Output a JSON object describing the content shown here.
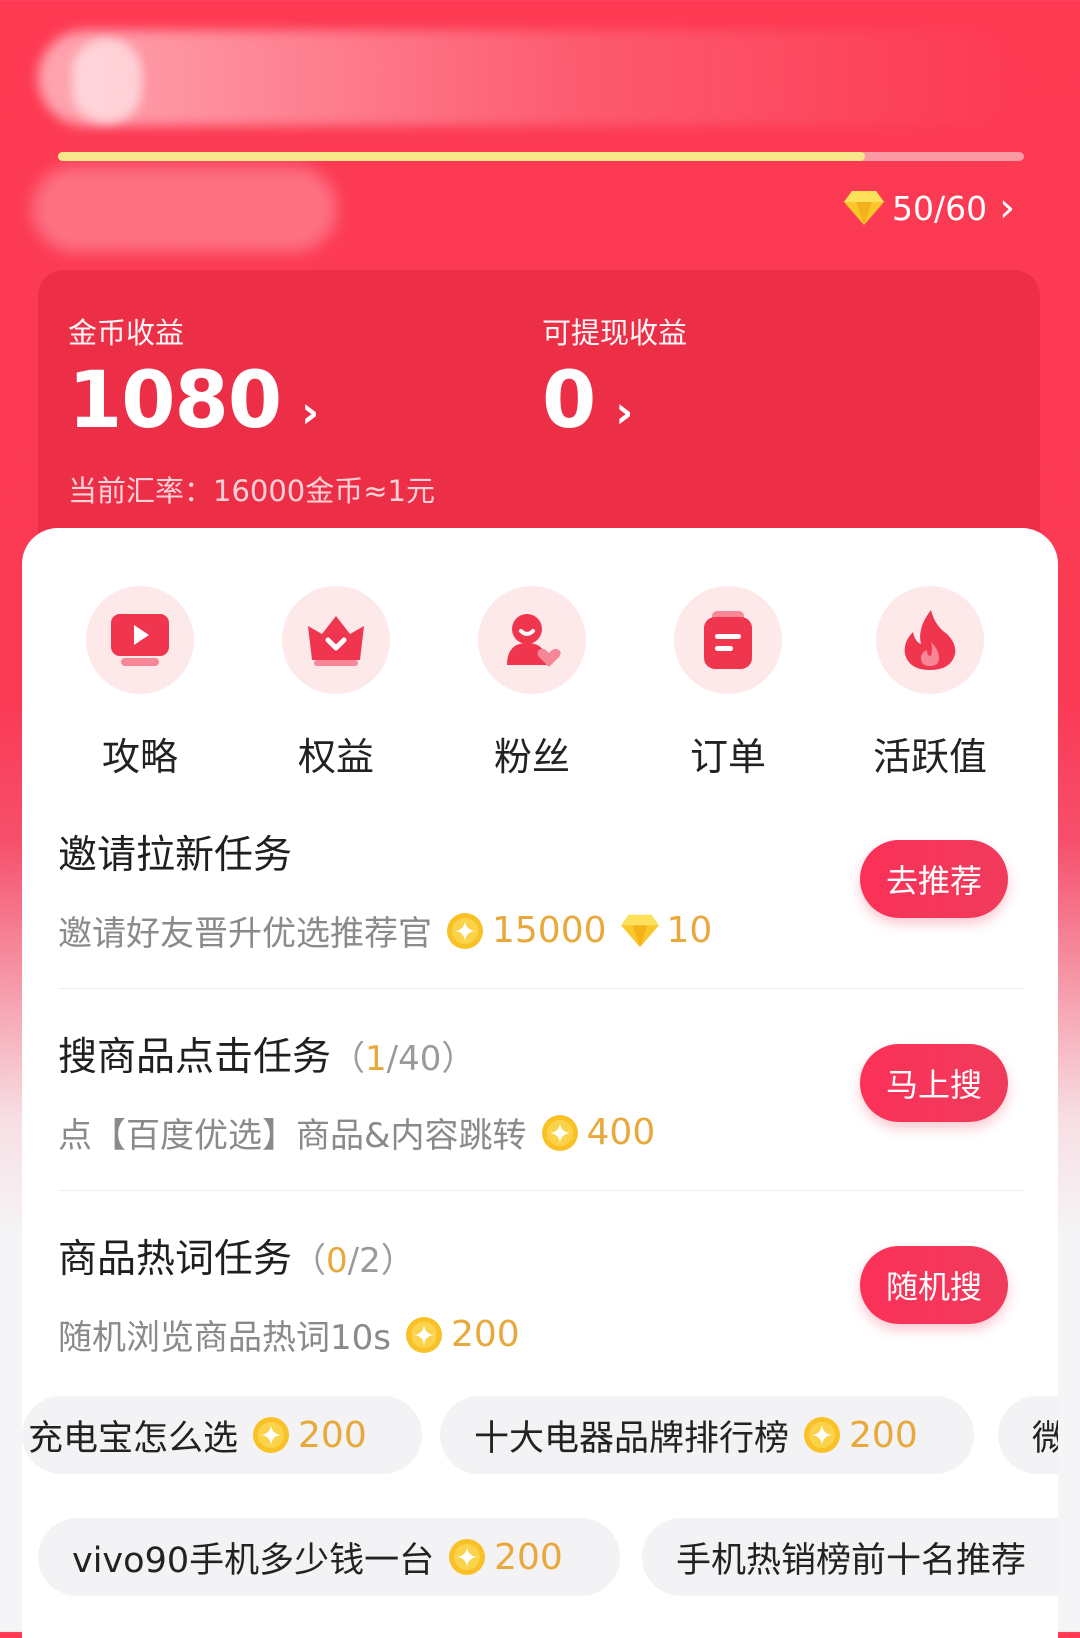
{
  "header": {
    "level_progress": 0.835,
    "gem_count": "50/60",
    "chevron": "›"
  },
  "earnings": {
    "coin_label": "金币收益",
    "coin_value": "1080",
    "cash_label": "可提现收益",
    "cash_value": "0",
    "arrow": "›",
    "rate_text": "当前汇率：16000金币≈1元"
  },
  "entries": [
    {
      "label": "攻略",
      "icon": "play-screen-icon"
    },
    {
      "label": "权益",
      "icon": "crown-heart-icon"
    },
    {
      "label": "粉丝",
      "icon": "fans-heart-icon"
    },
    {
      "label": "订单",
      "icon": "order-list-icon"
    },
    {
      "label": "活跃值",
      "icon": "flame-icon"
    }
  ],
  "tasks": [
    {
      "title": "邀请拉新任务",
      "desc": "邀请好友晋升优选推荐官",
      "coins": "15000",
      "gems": "10",
      "button": "去推荐"
    },
    {
      "title": "搜商品点击任务",
      "progress_open": "（",
      "progress_cur": "1",
      "progress_rest": "/40）",
      "desc": "点【百度优选】商品&内容跳转",
      "coins": "400",
      "button": "马上搜"
    },
    {
      "title": "商品热词任务",
      "progress_open": "（",
      "progress_cur": "0",
      "progress_rest": "/2）",
      "desc": "随机浏览商品热词10s",
      "coins": "200",
      "button": "随机搜"
    }
  ],
  "hotwords_row1": [
    {
      "text": "充电宝怎么选",
      "coins": "200"
    },
    {
      "text": "十大电器品牌排行榜",
      "coins": "200"
    },
    {
      "text": "微"
    }
  ],
  "hotwords_row2": [
    {
      "text": "vivo90手机多少钱一台",
      "coins": "200"
    },
    {
      "text": "手机热销榜前十名推荐"
    }
  ],
  "colors": {
    "brand_red": "#fd3a52",
    "gold": "#e8a93a",
    "button_red": "#fb3158"
  }
}
